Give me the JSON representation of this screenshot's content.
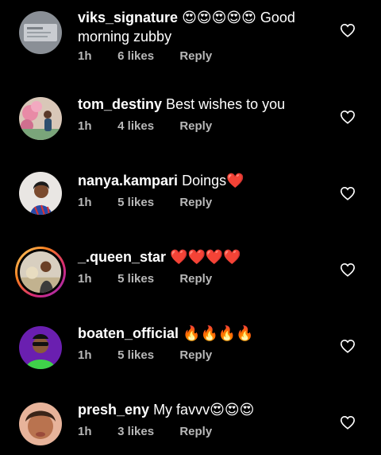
{
  "comments": [
    {
      "username": "viks_signature",
      "text": "😍😍😍😍😍 Good morning zubby",
      "time": "1h",
      "likes": "6 likes",
      "reply": "Reply",
      "avatar": "avatar-grey-card"
    },
    {
      "username": "tom_destiny",
      "text": "Best wishes to you",
      "time": "1h",
      "likes": "4 likes",
      "reply": "Reply",
      "avatar": "avatar-pink-flowers"
    },
    {
      "username": "nanya.kampari",
      "text": "Doings❤️",
      "time": "1h",
      "likes": "5 likes",
      "reply": "Reply",
      "avatar": "avatar-woman-blue"
    },
    {
      "username": "_.queen_star",
      "text": "❤️❤️❤️❤️",
      "time": "1h",
      "likes": "5 likes",
      "reply": "Reply",
      "avatar": "avatar-woman-story-ring"
    },
    {
      "username": "boaten_official",
      "text": "🔥🔥🔥🔥",
      "time": "1h",
      "likes": "5 likes",
      "reply": "Reply",
      "avatar": "avatar-cartoon-purple"
    },
    {
      "username": "presh_eny",
      "text": "My favvv😍😍😍",
      "time": "1h",
      "likes": "3 likes",
      "reply": "Reply",
      "avatar": "avatar-selfie-peach"
    }
  ],
  "icons": {
    "like": "heart-outline-icon"
  },
  "colors": {
    "background": "#000000",
    "meta": "#b8b8b8",
    "text": "#ffffff"
  }
}
